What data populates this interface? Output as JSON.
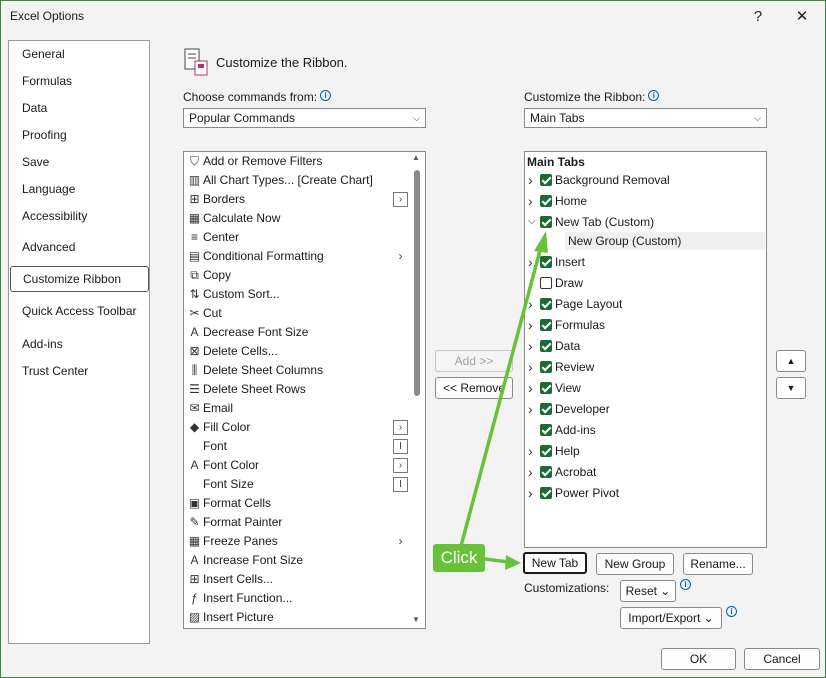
{
  "window": {
    "title": "Excel Options",
    "help_label": "?",
    "close_label": "✕"
  },
  "nav": {
    "items": [
      "General",
      "Formulas",
      "Data",
      "Proofing",
      "Save",
      "Language",
      "Accessibility",
      "Advanced",
      "Customize Ribbon",
      "Quick Access Toolbar",
      "Add-ins",
      "Trust Center"
    ],
    "selected": "Customize Ribbon"
  },
  "main": {
    "title": "Customize the Ribbon."
  },
  "left": {
    "choose_label": "Choose commands from:",
    "choose_value": "Popular Commands",
    "commands": [
      {
        "label": "Add or Remove Filters",
        "icon": "filter-icon"
      },
      {
        "label": "All Chart Types... [Create Chart]",
        "icon": "chart-icon"
      },
      {
        "label": "Borders",
        "icon": "borders-icon",
        "sub": "|>"
      },
      {
        "label": "Calculate Now",
        "icon": "calculator-icon"
      },
      {
        "label": "Center",
        "icon": "center-align-icon"
      },
      {
        "label": "Conditional Formatting",
        "icon": "conditional-formatting-icon",
        "sub": ">"
      },
      {
        "label": "Copy",
        "icon": "copy-icon"
      },
      {
        "label": "Custom Sort...",
        "icon": "sort-icon"
      },
      {
        "label": "Cut",
        "icon": "scissors-icon"
      },
      {
        "label": "Decrease Font Size",
        "icon": "decrease-font-icon"
      },
      {
        "label": "Delete Cells...",
        "icon": "delete-cells-icon"
      },
      {
        "label": "Delete Sheet Columns",
        "icon": "delete-columns-icon"
      },
      {
        "label": "Delete Sheet Rows",
        "icon": "delete-rows-icon"
      },
      {
        "label": "Email",
        "icon": "email-icon"
      },
      {
        "label": "Fill Color",
        "icon": "fill-color-icon",
        "sub": "|>"
      },
      {
        "label": "Font",
        "icon": "",
        "sub": "I~"
      },
      {
        "label": "Font Color",
        "icon": "font-color-icon",
        "sub": "|>"
      },
      {
        "label": "Font Size",
        "icon": "",
        "sub": "I~"
      },
      {
        "label": "Format Cells",
        "icon": "format-cells-icon"
      },
      {
        "label": "Format Painter",
        "icon": "paintbrush-icon"
      },
      {
        "label": "Freeze Panes",
        "icon": "freeze-panes-icon",
        "sub": ">"
      },
      {
        "label": "Increase Font Size",
        "icon": "increase-font-icon"
      },
      {
        "label": "Insert Cells...",
        "icon": "insert-cells-icon"
      },
      {
        "label": "Insert Function...",
        "icon": "function-icon"
      },
      {
        "label": "Insert Picture",
        "icon": "picture-icon"
      }
    ]
  },
  "middle": {
    "add_label": "Add >>",
    "remove_label": "<< Remove"
  },
  "right": {
    "customize_label": "Customize the Ribbon:",
    "customize_value": "Main Tabs",
    "tree_header": "Main Tabs",
    "tabs": [
      {
        "label": "Background Removal",
        "checked": true,
        "expander": ">"
      },
      {
        "label": "Home",
        "checked": true,
        "expander": ">"
      },
      {
        "label": "New Tab (Custom)",
        "checked": true,
        "expander": "v"
      },
      {
        "label": "Insert",
        "checked": true,
        "expander": ">"
      },
      {
        "label": "Draw",
        "checked": false,
        "expander": ""
      },
      {
        "label": "Page Layout",
        "checked": true,
        "expander": ">"
      },
      {
        "label": "Formulas",
        "checked": true,
        "expander": ">"
      },
      {
        "label": "Data",
        "checked": true,
        "expander": ">"
      },
      {
        "label": "Review",
        "checked": true,
        "expander": ">"
      },
      {
        "label": "View",
        "checked": true,
        "expander": ">"
      },
      {
        "label": "Developer",
        "checked": true,
        "expander": ">"
      },
      {
        "label": "Add-ins",
        "checked": true,
        "expander": ""
      },
      {
        "label": "Help",
        "checked": true,
        "expander": ">"
      },
      {
        "label": "Acrobat",
        "checked": true,
        "expander": ">"
      },
      {
        "label": "Power Pivot",
        "checked": true,
        "expander": ">"
      }
    ],
    "new_group": "New Group (Custom)",
    "new_tab_label": "New Tab",
    "new_group_label": "New Group",
    "rename_label": "Rename...",
    "customizations_label": "Customizations:",
    "reset_label": "Reset ⌄",
    "import_export_label": "Import/Export ⌄",
    "move_up": "▲",
    "move_down": "▼"
  },
  "footer": {
    "ok_label": "OK",
    "cancel_label": "Cancel"
  },
  "annotation": {
    "callout_text": "Click",
    "color": "#67c23a"
  }
}
